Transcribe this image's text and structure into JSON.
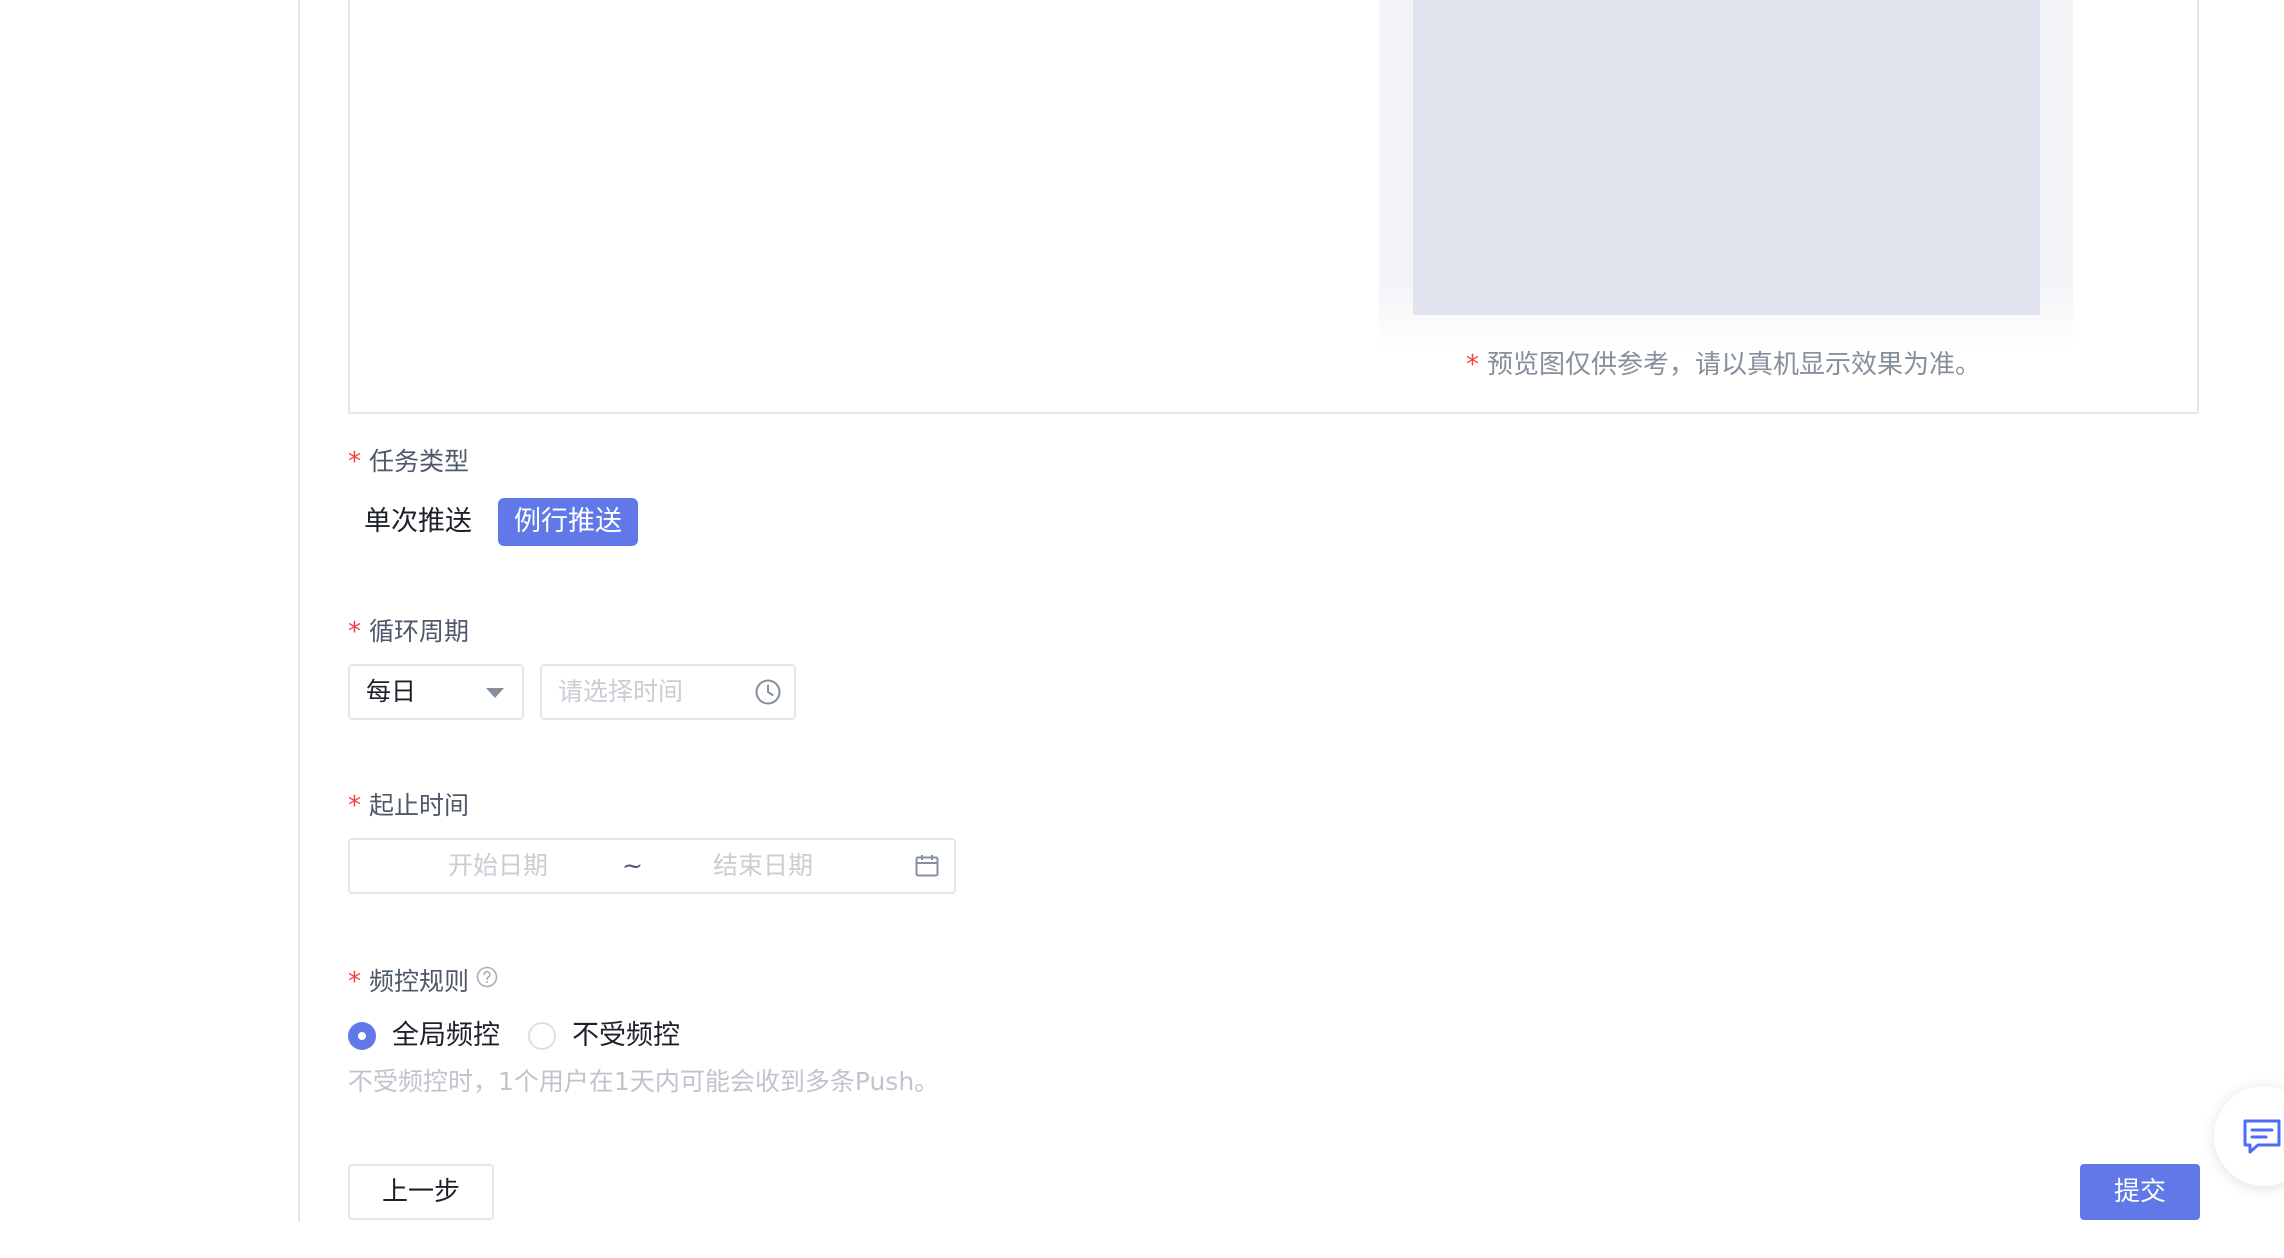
{
  "preview": {
    "note": "预览图仅供参考，请以真机显示效果为准。",
    "required_mark": "*"
  },
  "task_type": {
    "label": "任务类型",
    "required_mark": "*",
    "options": [
      "单次推送",
      "例行推送"
    ],
    "selected": "例行推送"
  },
  "cycle": {
    "label": "循环周期",
    "required_mark": "*",
    "select_value": "每日",
    "time_placeholder": "请选择时间"
  },
  "date_range": {
    "label": "起止时间",
    "required_mark": "*",
    "start_placeholder": "开始日期",
    "separator": "~",
    "end_placeholder": "结束日期"
  },
  "freq": {
    "label": "频控规则",
    "required_mark": "*",
    "options": [
      "全局频控",
      "不受频控"
    ],
    "selected": "全局频控",
    "hint": "不受频控时，1个用户在1天内可能会收到多条Push。"
  },
  "actions": {
    "prev": "上一步",
    "submit": "提交"
  },
  "colors": {
    "accent": "#6179e8",
    "required": "#f53f3f"
  },
  "icons": {
    "time": "clock-icon",
    "date": "calendar-icon",
    "help": "question-circle-icon",
    "feedback": "chat-icon"
  }
}
